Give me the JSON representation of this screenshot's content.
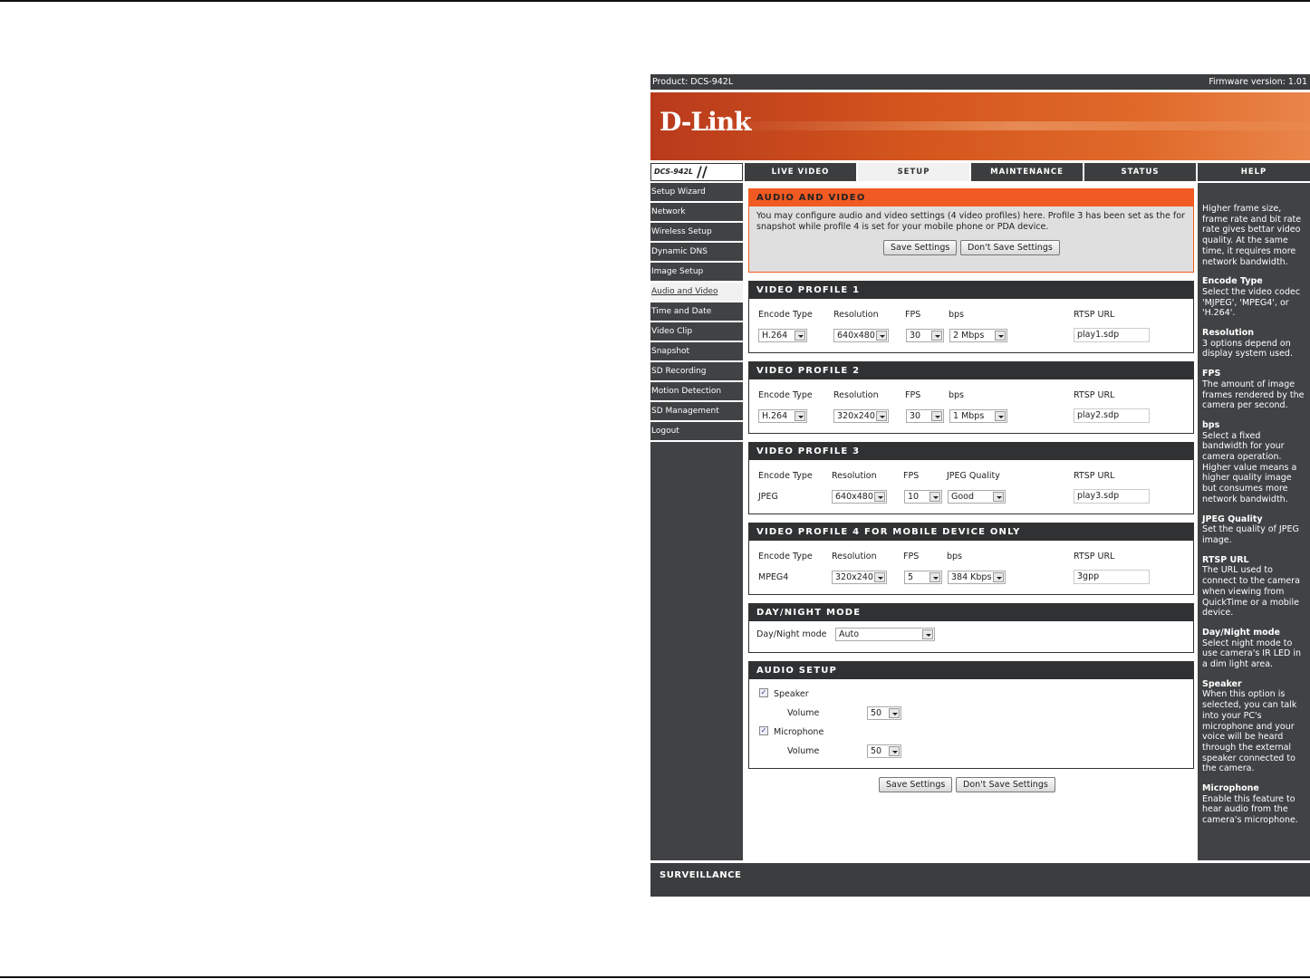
{
  "topbar": {
    "product": "Product: DCS-942L",
    "firmware": "Firmware version: 1.01"
  },
  "logo": "D-Link",
  "nav": {
    "model": "DCS-942L",
    "tabs": [
      "LIVE VIDEO",
      "SETUP",
      "MAINTENANCE",
      "STATUS",
      "HELP"
    ],
    "active": "SETUP"
  },
  "sidebar": [
    "Setup Wizard",
    "Network",
    "Wireless Setup",
    "Dynamic DNS",
    "Image Setup",
    "Audio and Video",
    "Time and Date",
    "Video Clip",
    "Snapshot",
    "SD Recording",
    "Motion Detection",
    "SD Management",
    "Logout"
  ],
  "intro": {
    "title": "AUDIO AND VIDEO",
    "text": "You may configure audio and video settings (4 video profiles) here. Profile 3 has been set as the for snapshot while profile 4 is set for your mobile phone or PDA device.",
    "save": "Save Settings",
    "dont_save": "Don't Save Settings"
  },
  "profiles": [
    {
      "title": "VIDEO PROFILE 1",
      "labels": [
        "Encode Type",
        "Resolution",
        "FPS",
        "bps",
        "RTSP URL"
      ],
      "encode": "H.264",
      "resolution": "640x480",
      "fps": "30",
      "bps": "2 Mbps",
      "rtsp": "play1.sdp"
    },
    {
      "title": "VIDEO PROFILE 2",
      "labels": [
        "Encode Type",
        "Resolution",
        "FPS",
        "bps",
        "RTSP URL"
      ],
      "encode": "H.264",
      "resolution": "320x240",
      "fps": "30",
      "bps": "1 Mbps",
      "rtsp": "play2.sdp"
    },
    {
      "title": "VIDEO PROFILE 3",
      "labels": [
        "Encode Type",
        "Resolution",
        "FPS",
        "JPEG Quality",
        "RTSP URL"
      ],
      "encode": "JPEG",
      "resolution": "640x480",
      "fps": "10",
      "bps": "Good",
      "rtsp": "play3.sdp"
    },
    {
      "title": "VIDEO PROFILE 4 FOR MOBILE DEVICE ONLY",
      "labels": [
        "Encode Type",
        "Resolution",
        "FPS",
        "bps",
        "RTSP URL"
      ],
      "encode": "MPEG4",
      "resolution": "320x240",
      "fps": "5",
      "bps": "384 Kbps",
      "rtsp": "3gpp"
    }
  ],
  "daynight": {
    "title": "DAY/NIGHT MODE",
    "label": "Day/Night mode",
    "value": "Auto"
  },
  "audio": {
    "title": "AUDIO SETUP",
    "speaker": "Speaker",
    "microphone": "Microphone",
    "volume_label": "Volume",
    "speaker_volume": "50",
    "mic_volume": "50",
    "speaker_checked": true,
    "mic_checked": true
  },
  "bottom": {
    "save": "Save Settings",
    "dont_save": "Don't Save Settings"
  },
  "help": [
    {
      "title": "",
      "text": "Higher frame size, frame rate and bit rate rate gives bettar video quality. At the same time, it requires more network bandwidth."
    },
    {
      "title": "Encode Type",
      "text": "Select the video codec 'MJPEG', 'MPEG4', or 'H.264'."
    },
    {
      "title": "Resolution",
      "text": "3 options depend on display system used."
    },
    {
      "title": "FPS",
      "text": "The amount of image frames rendered by the camera per second."
    },
    {
      "title": "bps",
      "text": "Select a fixed bandwidth for your camera operation. Higher value means a higher quality image but consumes more network bandwidth."
    },
    {
      "title": "JPEG Quality",
      "text": "Set the quality of JPEG image."
    },
    {
      "title": "RTSP URL",
      "text": "The URL used to connect to the camera when viewing from QuickTime or a mobile device."
    },
    {
      "title": "Day/Night mode",
      "text": "Select night mode to use camera's IR LED in a dim light area."
    },
    {
      "title": "Speaker",
      "text": "When this option is selected, you can talk into your PC's microphone and your voice will be heard through the external speaker connected to the camera."
    },
    {
      "title": "Microphone",
      "text": "Enable this feature to hear audio from the camera's microphone."
    }
  ],
  "footer": "SURVEILLANCE"
}
